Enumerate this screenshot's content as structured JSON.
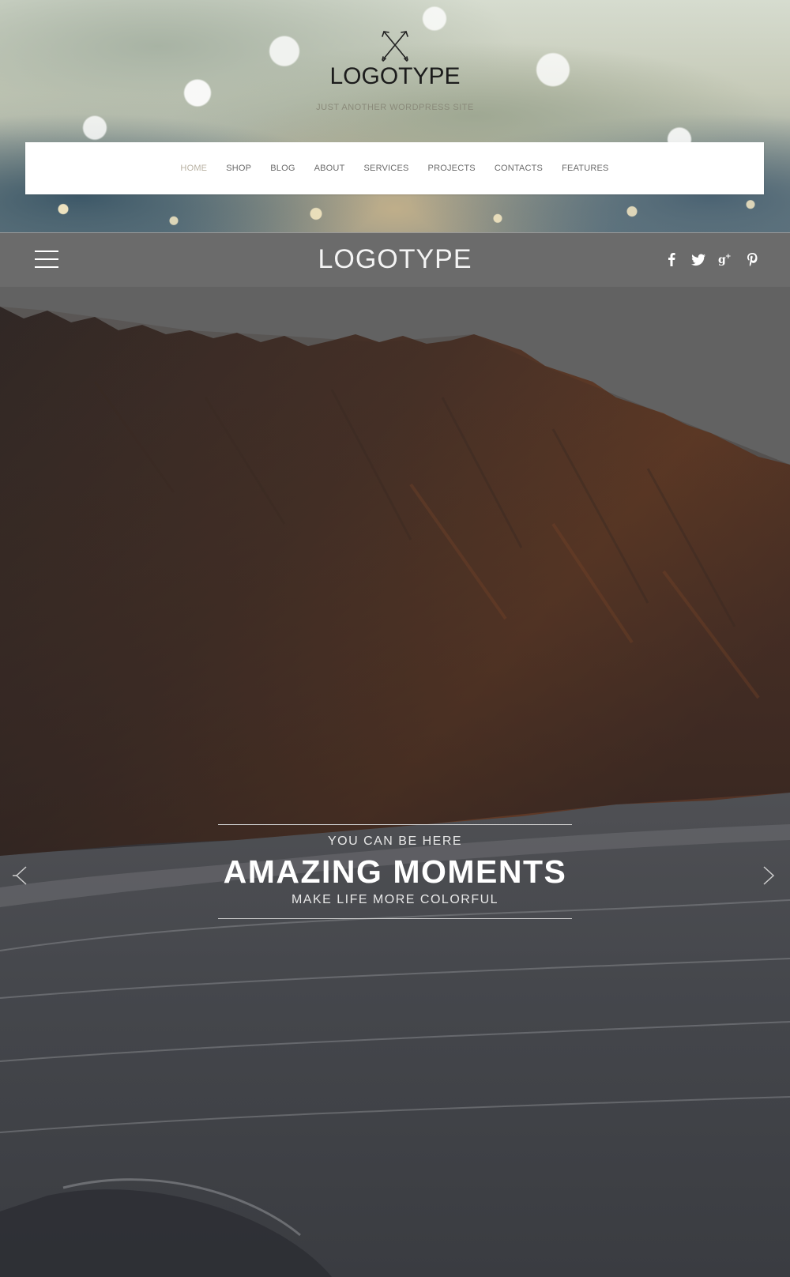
{
  "brand": {
    "title": "LOGOTYPE",
    "tagline": "JUST ANOTHER WORDPRESS SITE",
    "mark_icon": "crossed-arrows-icon"
  },
  "nav": {
    "items": [
      {
        "label": "HOME",
        "active": true
      },
      {
        "label": "SHOP",
        "active": false
      },
      {
        "label": "BLOG",
        "active": false
      },
      {
        "label": "ABOUT",
        "active": false
      },
      {
        "label": "SERVICES",
        "active": false
      },
      {
        "label": "PROJECTS",
        "active": false
      },
      {
        "label": "CONTACTS",
        "active": false
      },
      {
        "label": "FEATURES",
        "active": false
      }
    ]
  },
  "header_bar": {
    "logo": "LOGOTYPE",
    "menu_icon": "hamburger-icon",
    "social": [
      {
        "name": "facebook-icon",
        "glyph": "f"
      },
      {
        "name": "twitter-icon",
        "glyph": "t"
      },
      {
        "name": "google-plus-icon",
        "glyph": "g+"
      },
      {
        "name": "pinterest-icon",
        "glyph": "p"
      }
    ]
  },
  "hero": {
    "kicker": "YOU CAN BE HERE",
    "headline": "AMAZING MOMENTS",
    "subline": "MAKE LIFE MORE COLORFUL",
    "prev_icon": "chevron-left-icon",
    "next_icon": "chevron-right-icon"
  },
  "colors": {
    "nav_active": "#b9b2a3",
    "nav_text": "#6b6b6b",
    "header_bar": "#6b6b6b",
    "hero_text": "#ffffff"
  }
}
